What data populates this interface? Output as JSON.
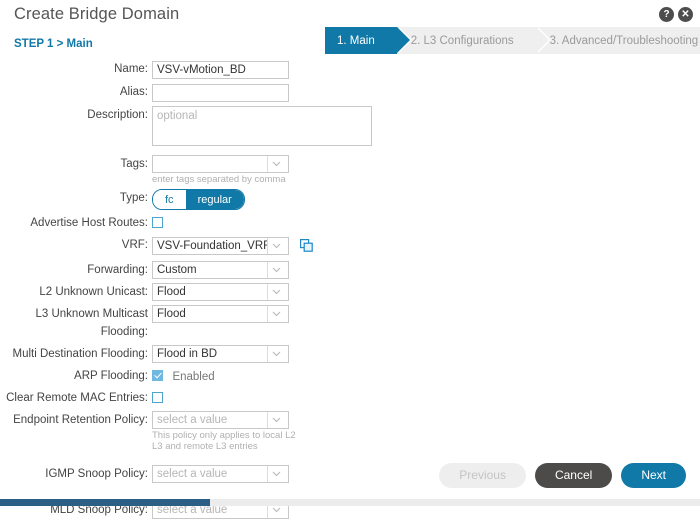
{
  "header": {
    "title": "Create Bridge Domain",
    "step_breadcrumb": "STEP 1 > Main",
    "help_icon": "?",
    "close_icon": "✕"
  },
  "wizard": {
    "steps": [
      {
        "label": "1. Main",
        "active": true
      },
      {
        "label": "2. L3 Configurations",
        "active": false
      },
      {
        "label": "3. Advanced/Troubleshooting",
        "active": false
      }
    ]
  },
  "form": {
    "name": {
      "label": "Name:",
      "value": "VSV-vMotion_BD"
    },
    "alias": {
      "label": "Alias:",
      "value": ""
    },
    "description": {
      "label": "Description:",
      "placeholder": "optional",
      "value": ""
    },
    "tags": {
      "label": "Tags:",
      "value": "",
      "hint": "enter tags separated by comma"
    },
    "type": {
      "label": "Type:",
      "option_off": "fc",
      "option_on": "regular",
      "selected": "regular"
    },
    "advertise_host_routes": {
      "label": "Advertise Host Routes:",
      "checked": false
    },
    "vrf": {
      "label": "VRF:",
      "value": "VSV-Foundation_VRF",
      "link_icon": "new-window-icon"
    },
    "forwarding": {
      "label": "Forwarding:",
      "value": "Custom"
    },
    "l2_unknown_unicast": {
      "label": "L2 Unknown Unicast:",
      "value": "Flood"
    },
    "l3_unknown_multicast": {
      "label": "L3 Unknown Multicast Flooding:",
      "value": "Flood"
    },
    "multi_destination": {
      "label": "Multi Destination Flooding:",
      "value": "Flood in BD"
    },
    "arp_flooding": {
      "label": "ARP Flooding:",
      "checked": true,
      "text": "Enabled"
    },
    "clear_remote_mac": {
      "label": "Clear Remote MAC Entries:",
      "checked": false
    },
    "endpoint_retention": {
      "label": "Endpoint Retention Policy:",
      "value": "select a value",
      "hint": "This policy only applies to local L2 L3 and remote L3 entries"
    },
    "igmp_snoop": {
      "label": "IGMP Snoop Policy:",
      "value": "select a value"
    },
    "mld_snoop": {
      "label": "MLD Snoop Policy:",
      "value": "select a value"
    }
  },
  "footer": {
    "previous": "Previous",
    "cancel": "Cancel",
    "next": "Next"
  },
  "colors": {
    "accent": "#1079a8",
    "cancel": "#4d4a4a",
    "scroll_thumb": "#2c5f86"
  }
}
